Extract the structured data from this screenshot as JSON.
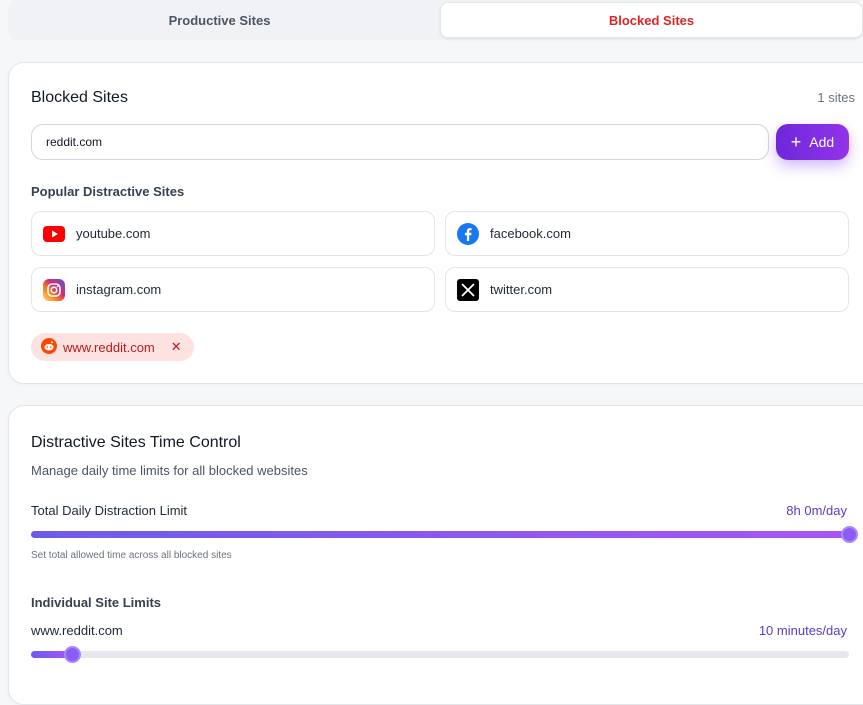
{
  "tabs": {
    "productive": "Productive Sites",
    "blocked": "Blocked Sites"
  },
  "blocked_card": {
    "title": "Blocked Sites",
    "count": "1 sites",
    "input_value": "reddit.com",
    "add_label": "Add",
    "popular_label": "Popular Distractive Sites",
    "popular_sites": [
      {
        "label": "youtube.com",
        "icon": "youtube-icon"
      },
      {
        "label": "facebook.com",
        "icon": "facebook-icon"
      },
      {
        "label": "instagram.com",
        "icon": "instagram-icon"
      },
      {
        "label": "twitter.com",
        "icon": "x-twitter-icon"
      }
    ],
    "blocked_chips": [
      {
        "label": "www.reddit.com",
        "icon": "reddit-icon"
      }
    ]
  },
  "time_card": {
    "title": "Distractive Sites Time Control",
    "subtitle": "Manage daily time limits for all blocked websites",
    "total_label": "Total Daily Distraction Limit",
    "total_value": "8h 0m/day",
    "total_level": 1.0,
    "total_hint": "Set total allowed time across all blocked sites",
    "individual_label": "Individual Site Limits",
    "sites": [
      {
        "name": "www.reddit.com",
        "value": "10 minutes/day",
        "level": 0.05
      }
    ]
  },
  "colors": {
    "accent": "#7c3aed",
    "blocked_tab": "#dc2626",
    "chip_bg": "#fde2e2"
  }
}
